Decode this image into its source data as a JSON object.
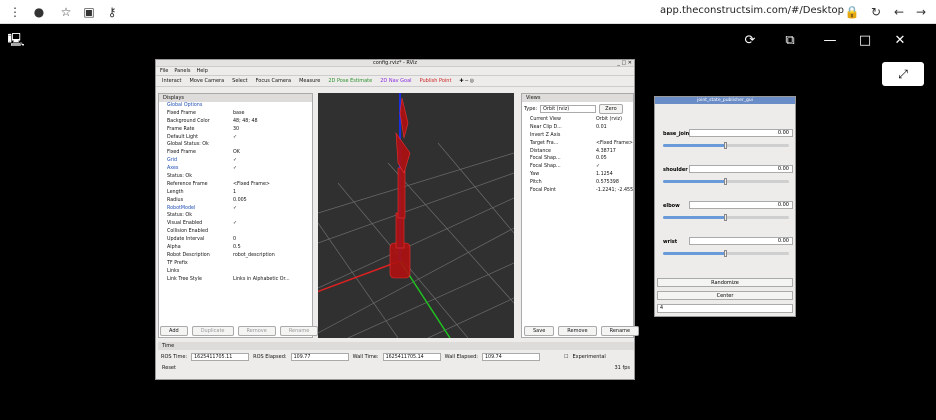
{
  "browser": {
    "url": "app.theconstructsim.com/#/Desktop"
  },
  "rviz": {
    "title": "config.rviz* - RViz",
    "menu": [
      "File",
      "Panels",
      "Help"
    ],
    "toolbar": [
      "Interact",
      "Move Camera",
      "Select",
      "Focus Camera",
      "Measure",
      "2D Pose Estimate",
      "2D Nav Goal",
      "Publish Point"
    ],
    "displays": {
      "title": "Displays",
      "rows": [
        {
          "k": "Global Options",
          "v": ""
        },
        {
          "k": "Fixed Frame",
          "v": "base"
        },
        {
          "k": "Background Color",
          "v": "48; 48; 48"
        },
        {
          "k": "Frame Rate",
          "v": "30"
        },
        {
          "k": "Default Light",
          "v": "✓"
        },
        {
          "k": "Global Status: Ok",
          "v": ""
        },
        {
          "k": "Fixed Frame",
          "v": "OK"
        },
        {
          "k": "Grid",
          "v": "✓"
        },
        {
          "k": "Axes",
          "v": "✓"
        },
        {
          "k": "Status: Ok",
          "v": ""
        },
        {
          "k": "Reference Frame",
          "v": "<Fixed Frame>"
        },
        {
          "k": "Length",
          "v": "1"
        },
        {
          "k": "Radius",
          "v": "0.005"
        },
        {
          "k": "RobotModel",
          "v": "✓"
        },
        {
          "k": "Status: Ok",
          "v": ""
        },
        {
          "k": "Visual Enabled",
          "v": "✓"
        },
        {
          "k": "Collision Enabled",
          "v": ""
        },
        {
          "k": "Update Interval",
          "v": "0"
        },
        {
          "k": "Alpha",
          "v": "0.5"
        },
        {
          "k": "Robot Description",
          "v": "robot_description"
        },
        {
          "k": "TF Prefix",
          "v": ""
        },
        {
          "k": "Links",
          "v": ""
        },
        {
          "k": "Link Tree Style",
          "v": "Links in Alphabetic Or..."
        }
      ],
      "buttons": [
        "Add",
        "Duplicate",
        "Remove",
        "Rename"
      ]
    },
    "views": {
      "title": "Views",
      "type_label": "Type:",
      "type_value": "Orbit (rviz)",
      "zero": "Zero",
      "rows": [
        {
          "k": "Current View",
          "v": "Orbit (rviz)"
        },
        {
          "k": "Near Clip D...",
          "v": "0.01"
        },
        {
          "k": "Invert Z Axis",
          "v": ""
        },
        {
          "k": "Target Fra...",
          "v": "<Fixed Frame>"
        },
        {
          "k": "Distance",
          "v": "4.38717"
        },
        {
          "k": "Focal Shap...",
          "v": "0.05"
        },
        {
          "k": "Focal Shap...",
          "v": "✓"
        },
        {
          "k": "Yaw",
          "v": "1.1254"
        },
        {
          "k": "Pitch",
          "v": "0.575398"
        },
        {
          "k": "Focal Point",
          "v": "-1.2241; -2.4556..."
        }
      ],
      "buttons": [
        "Save",
        "Remove",
        "Rename"
      ]
    },
    "time": {
      "title": "Time",
      "ros_time_label": "ROS Time:",
      "ros_time": "1625411705.11",
      "ros_elapsed_label": "ROS Elapsed:",
      "ros_elapsed": "109.77",
      "wall_time_label": "Wall Time:",
      "wall_time": "1625411705.14",
      "wall_elapsed_label": "Wall Elapsed:",
      "wall_elapsed": "109.74",
      "experimental": "Experimental",
      "reset": "Reset",
      "fps": "31 fps"
    }
  },
  "joint_gui": {
    "title": "joint_state_publisher_gui",
    "joints": [
      {
        "name": "base_joint",
        "value": "0.00",
        "level": 0.5
      },
      {
        "name": "shoulder",
        "value": "0.00",
        "level": 0.5
      },
      {
        "name": "elbow",
        "value": "0.00",
        "level": 0.5
      },
      {
        "name": "wrist",
        "value": "0.00",
        "level": 0.5
      }
    ],
    "randomize": "Randomize",
    "center": "Center",
    "spin_value": "4"
  }
}
